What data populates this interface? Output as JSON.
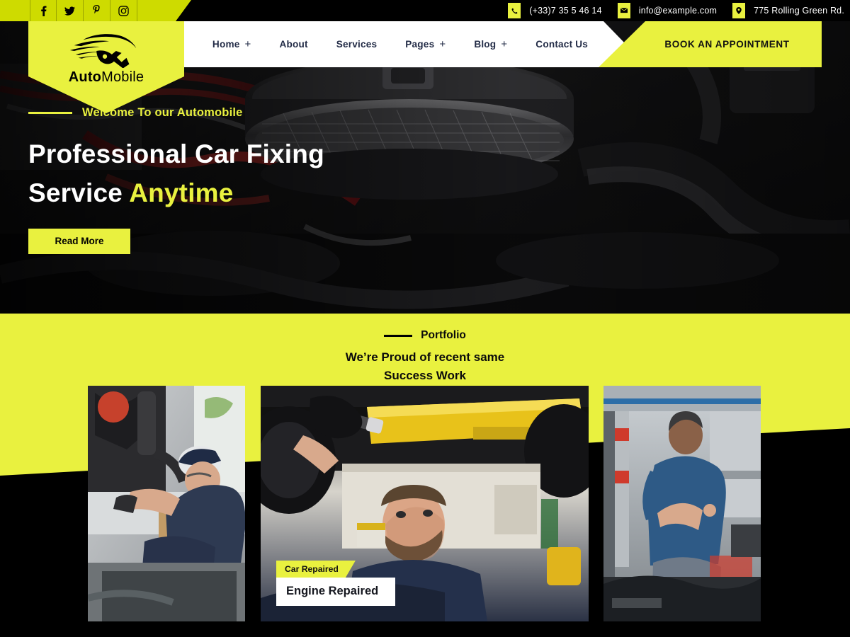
{
  "topbar": {
    "social": [
      {
        "name": "facebook-icon",
        "label": "Facebook"
      },
      {
        "name": "twitter-icon",
        "label": "Twitter"
      },
      {
        "name": "pinterest-icon",
        "label": "Pinterest"
      },
      {
        "name": "instagram-icon",
        "label": "Instagram"
      }
    ],
    "contacts": [
      {
        "icon": "phone-icon",
        "text": "(+33)7 35 5 46 14"
      },
      {
        "icon": "envelope-icon",
        "text": "info@example.com"
      },
      {
        "icon": "location-pin-icon",
        "text": "775 Rolling Green Rd."
      }
    ]
  },
  "logo": {
    "bold": "Auto",
    "regular": "Mobile"
  },
  "nav": {
    "items": [
      {
        "label": "Home",
        "has_submenu": true
      },
      {
        "label": "About",
        "has_submenu": false
      },
      {
        "label": "Services",
        "has_submenu": false
      },
      {
        "label": "Pages",
        "has_submenu": true
      },
      {
        "label": "Blog",
        "has_submenu": true
      },
      {
        "label": "Contact Us",
        "has_submenu": false
      }
    ],
    "cta": "BOOK AN APPOINTMENT"
  },
  "hero": {
    "eyebrow": "Welcome To our Automobile",
    "title_line1": "Professional Car Fixing",
    "title_line2_plain": "Service ",
    "title_line2_accent": "Anytime",
    "button": "Read More"
  },
  "portfolio": {
    "label": "Portfolio",
    "title_line1": "We’re Proud of recent same",
    "title_line2": "Success Work",
    "cards": [
      {
        "category": "",
        "title": "",
        "alt": "Mechanic working on a truck axle in a garage"
      },
      {
        "category": "Car Repaired",
        "title": "Engine Repaired",
        "alt": "Mechanic under a lifted car with a flashlight"
      },
      {
        "category": "",
        "title": "",
        "alt": "Mechanic servicing an engine bay in a workshop"
      }
    ]
  },
  "colors": {
    "brand_yellow": "#e9f13f",
    "topbar_yellow": "#cedb00",
    "nav_text": "#232c47",
    "black": "#000000",
    "white": "#ffffff"
  }
}
